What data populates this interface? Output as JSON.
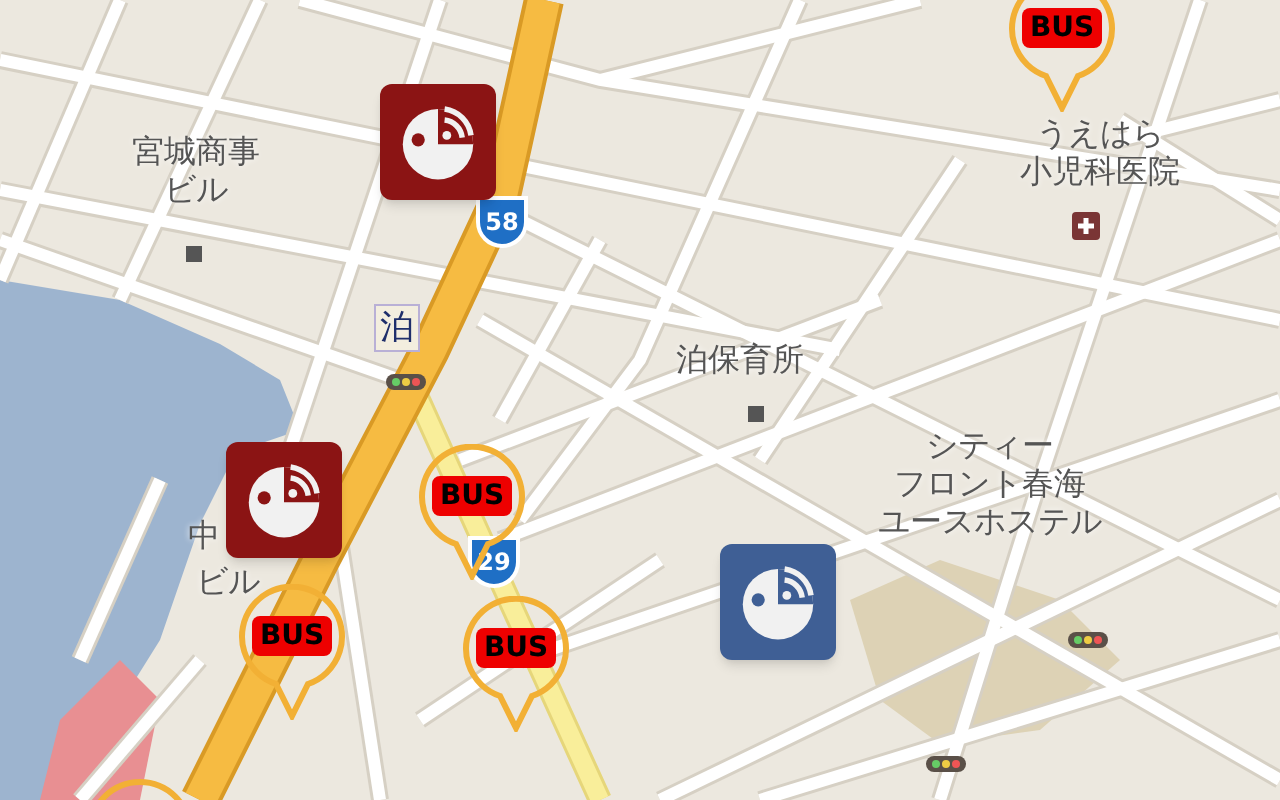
{
  "map_labels": [
    {
      "lines": [
        "宮城商事",
        "ビル"
      ]
    },
    {
      "lines": [
        "泊"
      ]
    },
    {
      "lines": [
        "泊保育所"
      ]
    },
    {
      "lines": [
        "うえはら",
        "小児科医院"
      ]
    },
    {
      "lines": [
        "シティー",
        "フロント春海",
        "ユースホステル"
      ]
    },
    {
      "lines": [
        "中"
      ]
    },
    {
      "lines": [
        "ビル"
      ]
    }
  ],
  "route_shields": [
    "58",
    "29"
  ],
  "markers": [
    {
      "kind": "radio",
      "color": "#8b1414"
    },
    {
      "kind": "radio",
      "color": "#8b1414"
    },
    {
      "kind": "radio",
      "color": "#3f5f95"
    },
    {
      "kind": "bus",
      "label": "BUS"
    },
    {
      "kind": "bus",
      "label": "BUS"
    },
    {
      "kind": "bus",
      "label": "BUS"
    },
    {
      "kind": "bus",
      "label": "BUS"
    },
    {
      "kind": "pin"
    }
  ]
}
